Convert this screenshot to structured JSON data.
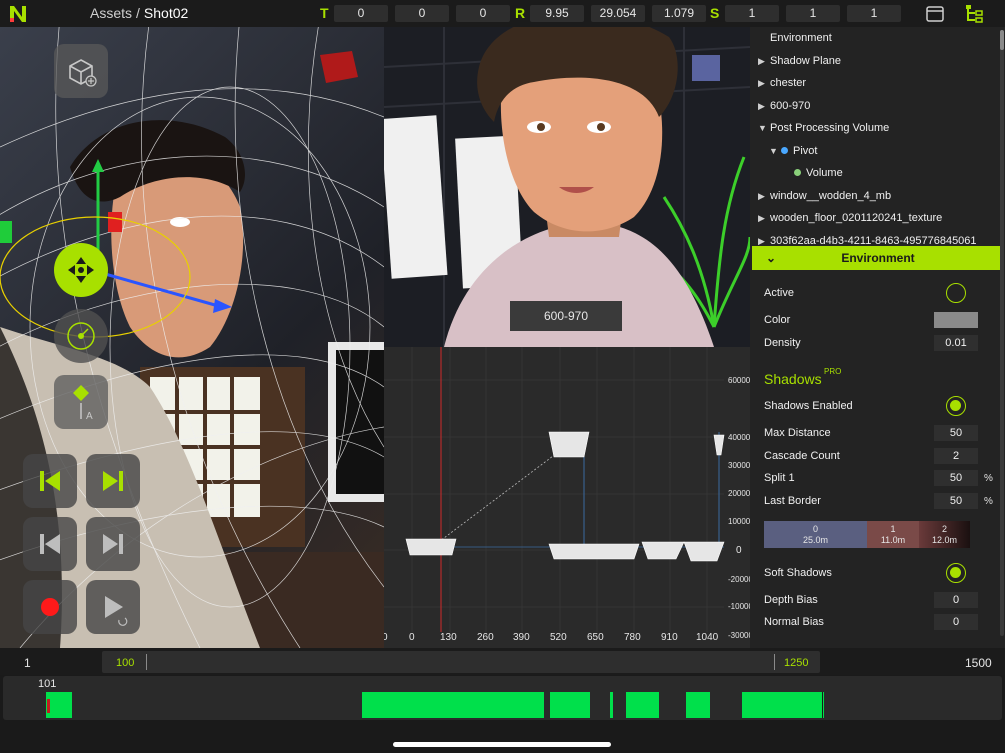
{
  "topbar": {
    "breadcrumb": {
      "root": "Assets",
      "separator": "/",
      "current": "Shot02"
    },
    "transform": {
      "t_label": "T",
      "t_values": [
        "0",
        "0",
        "0"
      ],
      "r_label": "R",
      "r_values": [
        "9.95",
        "29.054",
        "1.079"
      ],
      "s_label": "S",
      "s_values": [
        "1",
        "1",
        "1"
      ]
    },
    "icons": [
      "window-icon",
      "hierarchy-icon"
    ]
  },
  "viewport": {
    "tools": [
      "add-object-icon",
      "move-gizmo-icon",
      "orbit-icon",
      "keyframe-icon",
      "skip-start-icon",
      "skip-end-icon",
      "step-back-icon",
      "step-forward-icon",
      "record-icon",
      "play-icon"
    ],
    "keyframe_sub": "A"
  },
  "camera": {
    "label": "600-970"
  },
  "graph": {
    "y_ticks": [
      "60000",
      "40000",
      "30000",
      "20000",
      "10000",
      "0",
      "-10000",
      "-20000",
      "-30000"
    ],
    "x_ticks": [
      "0",
      "0",
      "130",
      "260",
      "390",
      "520",
      "650",
      "780",
      "910",
      "1040"
    ]
  },
  "hierarchy": {
    "items": [
      {
        "label": "Environment",
        "caret": ""
      },
      {
        "label": "Shadow Plane",
        "caret": "▶"
      },
      {
        "label": "chester",
        "caret": "▶"
      },
      {
        "label": "600-970",
        "caret": "▶"
      },
      {
        "label": "Post Processing Volume",
        "caret": "▼"
      },
      {
        "label": "Pivot",
        "caret": "▼"
      },
      {
        "label": "Volume",
        "caret": ""
      },
      {
        "label": "window__wodden_4_mb",
        "caret": "▶"
      },
      {
        "label": "wooden_floor_0201120241_texture",
        "caret": "▶"
      },
      {
        "label": "303f62aa-d4b3-4211-8463-495776845061",
        "caret": "▶"
      }
    ]
  },
  "environment": {
    "title": "Environment",
    "active_label": "Active",
    "color_label": "Color",
    "color_value": "#8a8a8a",
    "density_label": "Density",
    "density_value": "0.01"
  },
  "shadows": {
    "title": "Shadows",
    "badge": "PRO",
    "enabled_label": "Shadows Enabled",
    "max_distance_label": "Max Distance",
    "max_distance": "50",
    "cascade_count_label": "Cascade Count",
    "cascade_count": "2",
    "split1_label": "Split 1",
    "split1": "50",
    "last_border_label": "Last Border",
    "last_border": "50",
    "percent": "%",
    "cascades": [
      {
        "index": "0",
        "dist": "25.0m"
      },
      {
        "index": "1",
        "dist": "11.0m"
      },
      {
        "index": "2",
        "dist": "12.0m"
      }
    ],
    "soft_label": "Soft Shadows",
    "depth_bias_label": "Depth Bias",
    "depth_bias": "0",
    "normal_bias_label": "Normal Bias",
    "normal_bias": "0"
  },
  "timeline": {
    "start": "1",
    "range_start": "100",
    "range_end": "1250",
    "end": "1500",
    "current_frame": "101"
  },
  "colors": {
    "accent": "#a8e000",
    "clip": "#00e04b",
    "panel": "#232323"
  }
}
